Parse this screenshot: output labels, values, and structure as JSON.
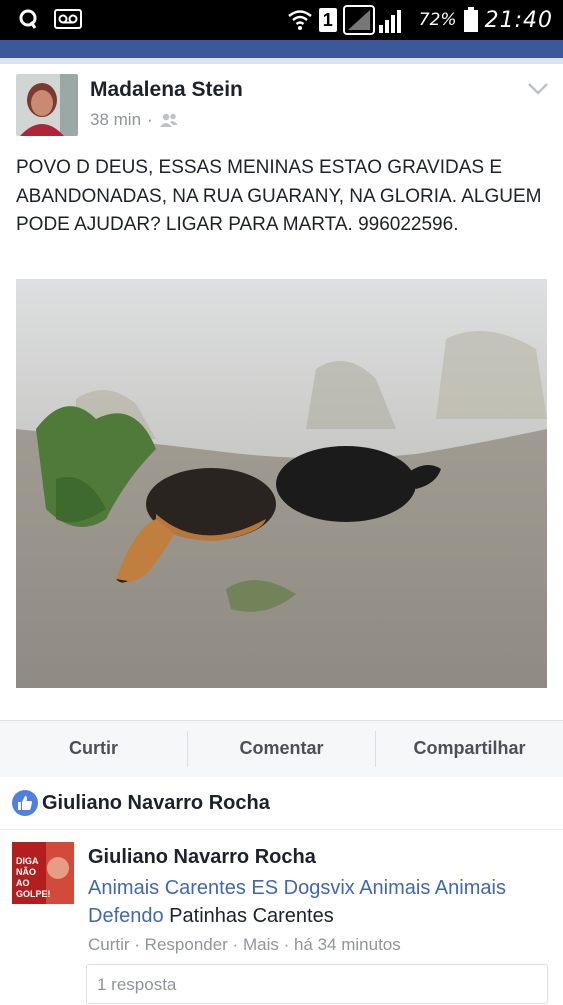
{
  "status_bar": {
    "battery_percent": "72%",
    "time": "21:40",
    "sim_slot": "1",
    "icons": [
      "circle-app-icon",
      "voicemail-icon",
      "wifi-icon",
      "sim-icon",
      "signal-icon",
      "battery-icon"
    ]
  },
  "post": {
    "author": "Madalena Stein",
    "time": "38 min",
    "separator": "·",
    "privacy_icon": "friends-icon",
    "text": "POVO D DEUS, ESSAS MENINAS ESTAO GRAVIDAS E ABANDONADAS, NA RUA GUARANY, NA GLORIA. ALGUEM PODE AJUDAR? LIGAR PARA MARTA. 996022596.",
    "photo_subject": "two dogs lying on sandy ground against a wall"
  },
  "actions": {
    "like": "Curtir",
    "comment": "Comentar",
    "share": "Compartilhar"
  },
  "likers": {
    "name": "Giuliano Navarro Rocha"
  },
  "comment": {
    "author": "Giuliano Navarro Rocha",
    "tags": "Animais Carentes ES Dogsvix Animais Animais Defendo",
    "text_after": " Patinhas Carentes",
    "like": "Curtir",
    "reply": "Responder",
    "more": "Mais",
    "time": "há 34 minutos",
    "sep": " · ",
    "avatar_caption": "DIGA NÃO AO GOLPE!",
    "replies": "1 resposta"
  },
  "colors": {
    "facebook_blue": "#3b5998",
    "link_blue": "#4267b2",
    "secondary_text": "#90949c",
    "like_blue": "#4f80e1"
  }
}
